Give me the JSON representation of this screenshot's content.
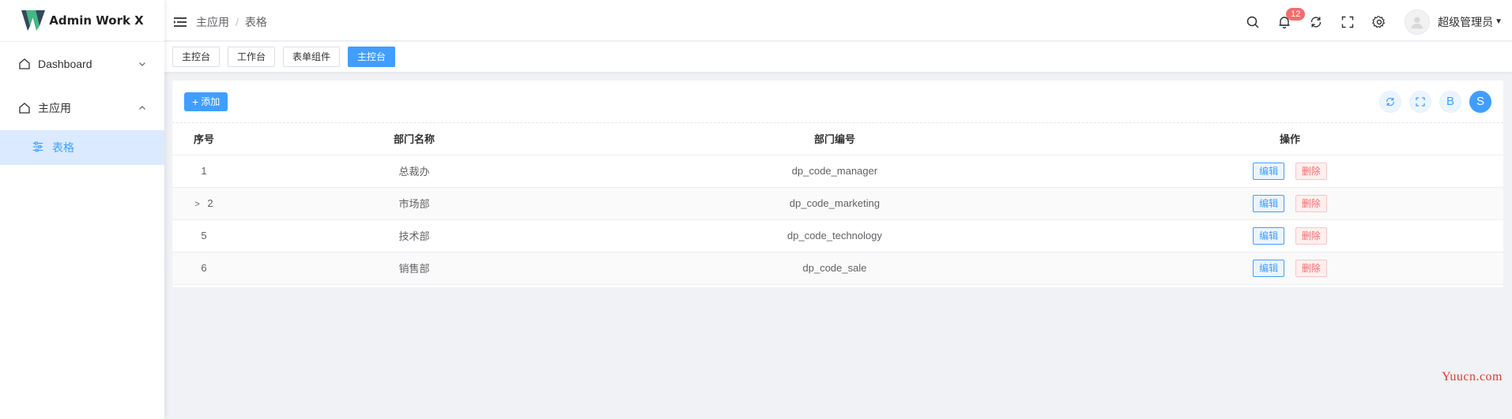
{
  "app": {
    "title": "Admin Work X"
  },
  "sidebar": {
    "items": [
      {
        "label": "Dashboard",
        "icon": "home-icon",
        "arrow": "chevron-down-icon"
      },
      {
        "label": "主应用",
        "icon": "home-icon",
        "arrow": "chevron-up-icon"
      },
      {
        "label": "表格",
        "icon": "sliders-icon",
        "active": true
      }
    ]
  },
  "header": {
    "breadcrumb": [
      "主应用",
      "表格"
    ],
    "breadcrumb_sep": "/",
    "notification_count": "12",
    "username": "超级管理员"
  },
  "tabs": [
    {
      "label": "主控台"
    },
    {
      "label": "工作台"
    },
    {
      "label": "表单组件"
    },
    {
      "label": "主控台",
      "active": true
    }
  ],
  "toolbar": {
    "add_label": "添加",
    "btn_b": "B",
    "btn_s": "S"
  },
  "table": {
    "headers": [
      "序号",
      "部门名称",
      "部门编号",
      "操作"
    ],
    "rows": [
      {
        "index": "1",
        "name": "总裁办",
        "code": "dp_code_manager",
        "expandable": false
      },
      {
        "index": "2",
        "name": "市场部",
        "code": "dp_code_marketing",
        "expandable": true
      },
      {
        "index": "5",
        "name": "技术部",
        "code": "dp_code_technology",
        "expandable": false
      },
      {
        "index": "6",
        "name": "销售部",
        "code": "dp_code_sale",
        "expandable": false
      }
    ],
    "edit_label": "编辑",
    "delete_label": "删除"
  },
  "watermark": "Yuucn.com",
  "colors": {
    "primary": "#409eff",
    "danger": "#f56c6c",
    "active_bg": "#dbeafe"
  }
}
